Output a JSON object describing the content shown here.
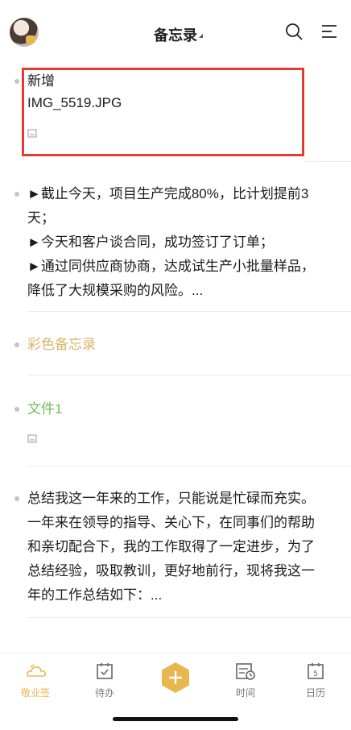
{
  "header": {
    "title": "备忘录"
  },
  "notes": [
    {
      "title": "新增",
      "line2": "IMG_5519.JPG"
    },
    {
      "body": "►截止今天，项目生产完成80%，比计划提前3天；\n►今天和客户谈合同，成功签订了订单；\n►通过同供应商协商，达成试生产小批量样品，降低了大规模采购的风险。..."
    },
    {
      "title": "彩色备忘录",
      "color": "#d9b46a"
    },
    {
      "title": "文件1",
      "color": "#6cc05a"
    },
    {
      "body": "总结我这一年来的工作，只能说是忙碌而充实。一年来在领导的指导、关心下，在同事们的帮助和亲切配合下，我的工作取得了一定进步，为了总结经验，吸取教训，更好地前行，现将我这一年的工作总结如下：..."
    }
  ],
  "tabbar": {
    "items": [
      {
        "label": "敬业签",
        "active": true
      },
      {
        "label": "待办"
      },
      {
        "label": "时间"
      },
      {
        "label": "日历"
      }
    ],
    "accent": "#e9b74f"
  }
}
